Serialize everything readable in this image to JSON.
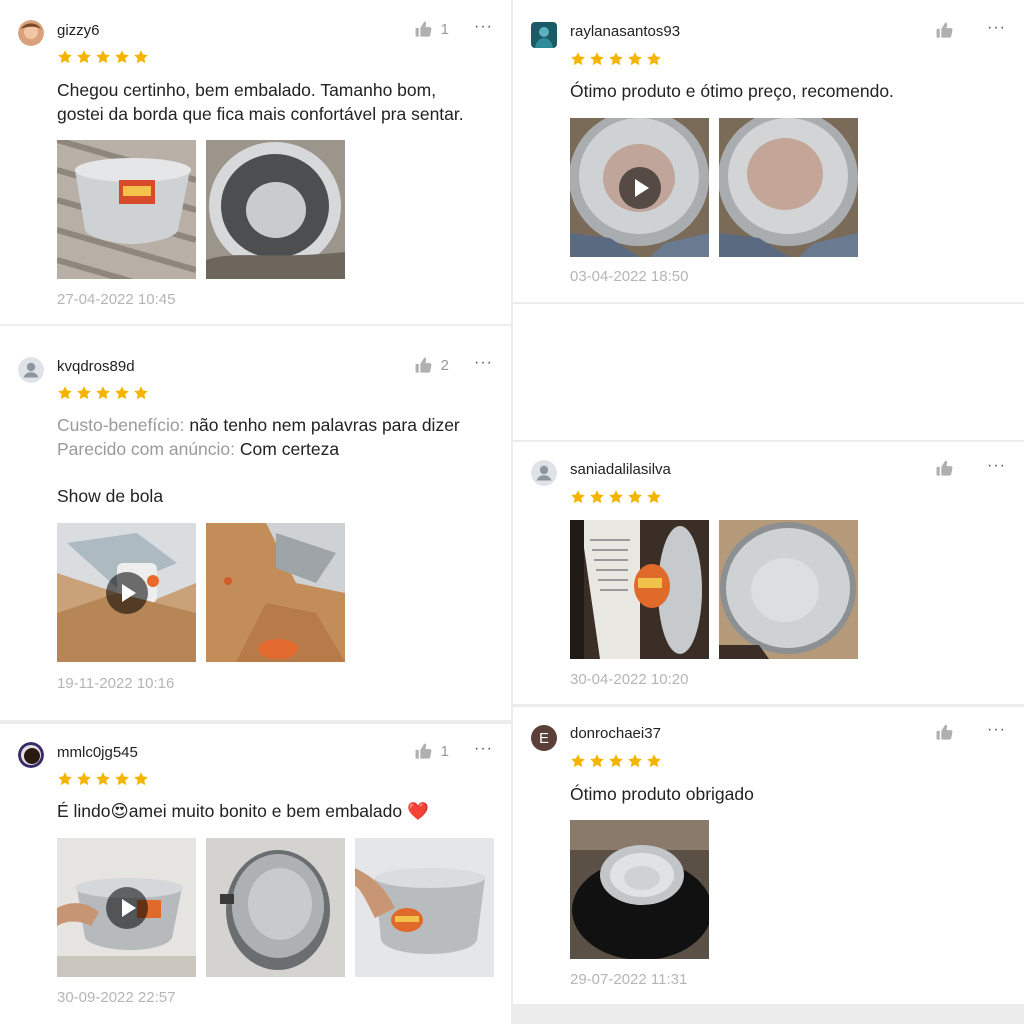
{
  "colors": {
    "star": "#f5b400",
    "heart": "#e8202a",
    "muted": "#9a9a9a"
  },
  "reviews": [
    {
      "username": "gizzy6",
      "likes": "1",
      "rating": 5,
      "text": [
        "Chegou certinho, bem embalado. Tamanho bom,",
        "gostei da borda que fica mais confortável pra sentar."
      ],
      "date": "27-04-2022 10:45",
      "media": [
        "photo",
        "photo"
      ]
    },
    {
      "username": "kvqdros89d",
      "likes": "2",
      "rating": 5,
      "attributes": [
        {
          "label": "Custo-benefício:",
          "value": "não tenho nem palavras para dizer"
        },
        {
          "label": "Parecido com anúncio:",
          "value": "Com certeza"
        }
      ],
      "text_after": "Show de bola",
      "date": "19-11-2022 10:16",
      "media": [
        "video",
        "photo"
      ]
    },
    {
      "username": "mmlc0jg545",
      "likes": "1",
      "rating": 5,
      "text_a": "É lindo",
      "emoji": "😍",
      "text_b": "amei muito bonito e bem embalado ",
      "heart": "❤️",
      "date": "30-09-2022 22:57",
      "media": [
        "video",
        "photo",
        "photo"
      ]
    },
    {
      "username": "raylanasantos93",
      "likes": "",
      "rating": 5,
      "text": "Ótimo produto e ótimo preço, recomendo.",
      "date": "03-04-2022 18:50",
      "media": [
        "video",
        "photo"
      ]
    },
    {
      "username": "saniadalilasilva",
      "likes": "",
      "rating": 5,
      "date": "30-04-2022 10:20",
      "media": [
        "photo",
        "photo"
      ]
    },
    {
      "username": "donrochaei37",
      "avatar_letter": "E",
      "likes": "",
      "rating": 5,
      "text": "Ótimo produto obrigado",
      "date": "29-07-2022 11:31",
      "media": [
        "photo"
      ]
    }
  ]
}
